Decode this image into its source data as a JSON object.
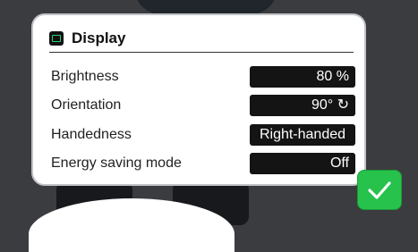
{
  "dialog": {
    "title": "Display",
    "rows": [
      {
        "label": "Brightness",
        "value": "80 %"
      },
      {
        "label": "Orientation",
        "value": "90° ↻"
      },
      {
        "label": "Handedness",
        "value": "Right-handed"
      },
      {
        "label": "Energy saving mode",
        "value": "Off"
      }
    ]
  },
  "icons": {
    "title": "display-icon",
    "confirm": "checkmark-icon"
  },
  "colors": {
    "confirm": "#27c24c",
    "value_bg": "#141414",
    "background": "#3b3c3f"
  }
}
